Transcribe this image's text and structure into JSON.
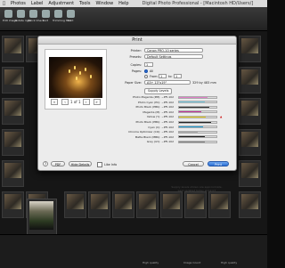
{
  "menubar": {
    "items": [
      "Photos",
      "Label",
      "Adjustment",
      "Tools",
      "Window",
      "Help"
    ],
    "window_title": "Digital Photo Professional - [Macintosh HD/Users/]"
  },
  "toolbar": {
    "buttons": [
      "Edit image",
      "Rotate right",
      "Quick Check",
      "Sort",
      "Trimming Tool",
      "Print"
    ]
  },
  "dialog": {
    "title": "Print",
    "printer_label": "Printer:",
    "printer_value": "Canon PRO-10 series",
    "presets_label": "Presets:",
    "presets_value": "Default Settings",
    "copies_label": "Copies:",
    "copies_value": "1",
    "pages_label": "Pages:",
    "pages_all": "All",
    "from_label": "From:",
    "from_value": "1",
    "to_label": "to:",
    "to_value": "1",
    "paper_size_label": "Paper Size:",
    "paper_size_value": "A3+ 13\"x19\"",
    "paper_dims": "329 by 483 mm",
    "tab_selector": "Supply Levels",
    "page_indicator": "1 of 1",
    "supply_note": "Supply levels shown are approximate. Last updated today at 12:07",
    "buttons": {
      "pdf": "PDF",
      "hide_details": "Hide Details",
      "cancel": "Cancel",
      "print": "Print"
    },
    "help": "?",
    "like_info": "Like Info"
  },
  "supply_levels": [
    {
      "name": "Photo Magenta (PM): ~PFI-102",
      "color": "#e080c8",
      "level": 0.75,
      "warn": false
    },
    {
      "name": "Photo Cyan (PC): ~PFI-102",
      "color": "#7ad0e8",
      "level": 0.7,
      "warn": false
    },
    {
      "name": "Photo Black (PBK): ~PFI-102",
      "color": "#333333",
      "level": 0.8,
      "warn": false
    },
    {
      "name": "Magenta (M): ~PFI-102",
      "color": "#c0329a",
      "level": 0.6,
      "warn": false
    },
    {
      "name": "Yellow (Y): ~PFI-102",
      "color": "#e8d020",
      "level": 0.72,
      "warn": true
    },
    {
      "name": "Photo Black (PBK): ~PFI-102",
      "color": "#222222",
      "level": 0.85,
      "warn": false
    },
    {
      "name": "Cyan (C): ~PFI-102",
      "color": "#1ea0d8",
      "level": 0.65,
      "warn": false
    },
    {
      "name": "Chroma Optimizer (CO): ~PFI-102",
      "color": "#aaaaaa",
      "level": 0.5,
      "warn": false
    },
    {
      "name": "Matte Black (MBK): ~PFI-102",
      "color": "#1a1a1a",
      "level": 0.7,
      "warn": false
    },
    {
      "name": "Gray (GY): ~PFI-102",
      "color": "#888888",
      "level": 0.68,
      "warn": false
    }
  ],
  "statusbar": {
    "left": "High quality",
    "mid": "Image Count",
    "right": "High quality"
  }
}
